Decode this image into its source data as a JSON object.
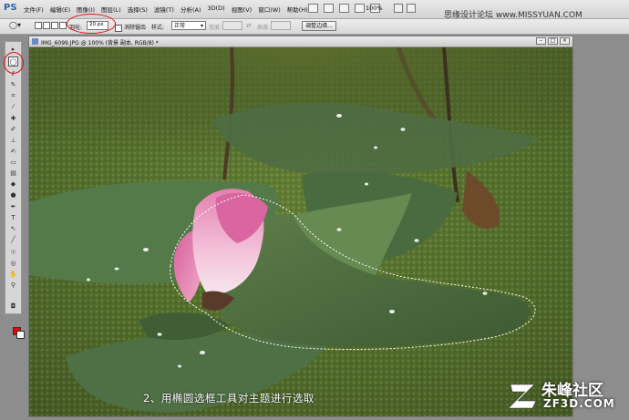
{
  "menubar": {
    "logo": "PS",
    "menus": [
      "文件(F)",
      "编辑(E)",
      "图像(I)",
      "图层(L)",
      "选择(S)",
      "滤镜(T)",
      "分析(A)",
      "3D(D)",
      "视图(V)",
      "窗口(W)",
      "帮助(H)"
    ],
    "zoom": "100%",
    "watermark": "思缘设计论坛 www.MISSYUAN.COM"
  },
  "options": {
    "feather_label": "羽化:",
    "feather_value": "20 px",
    "antialias_label": "消除锯齿",
    "style_label": "样式:",
    "style_value": "正常",
    "width_label": "宽度:",
    "height_label": "高度:",
    "refine_edge": "调整边缘..."
  },
  "document": {
    "title": "IMG_6099.JPG @ 100% (背景 副本, RGB/8) *",
    "caption": "2、用椭圆选框工具对主题进行选取"
  },
  "logo": {
    "name": "朱峰社区",
    "domain": "ZF3D.COM"
  },
  "colors": {
    "highlight": "#dd1111",
    "foreground": "#ee0000",
    "background": "#ffffff"
  }
}
